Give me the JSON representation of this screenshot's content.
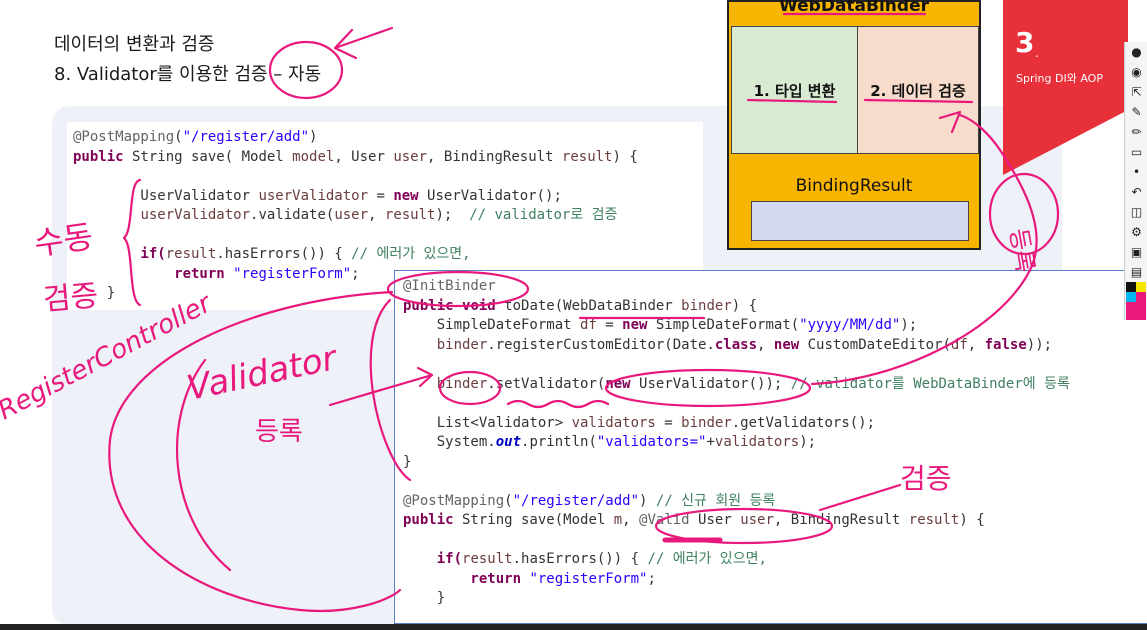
{
  "slide": {
    "heading_line1": "데이터의 변환과 검증",
    "heading_line2": "8. Validator를 이용한 검증 – 자동"
  },
  "code_top": {
    "l1_annot": "@PostMapping",
    "l1_str": "\"/register/add\"",
    "l2a": "public",
    "l2b": " String save( Model ",
    "l2c": "model",
    "l2d": ", User ",
    "l2e": "user",
    "l2f": ", BindingResult ",
    "l2g": "result",
    "l2h": ") {",
    "l3a": "        UserValidator ",
    "l3b": "userValidator",
    "l3c": " = ",
    "l3d": "new",
    "l3e": " UserValidator();",
    "l4a": "        ",
    "l4b": "userValidator",
    "l4c": ".validate(",
    "l4d": "user",
    "l4e": ", ",
    "l4f": "result",
    "l4g": ");  ",
    "l4h": "// validator로 검증",
    "l5a": "        if(",
    "l5b": "result",
    "l5c": ".hasErrors()) { ",
    "l5d": "// 에러가 있으면,",
    "l6a": "            return",
    "l6b": " ",
    "l6c": "\"registerForm\"",
    "l6d": ";",
    "l7": "    }"
  },
  "code_bottom": {
    "b1": "@InitBinder",
    "b2a": "public",
    "b2b": " ",
    "b2c": "void",
    "b2d": " toDate(WebDataBinder ",
    "b2e": "binder",
    "b2f": ") {",
    "b3a": "    SimpleDateFormat ",
    "b3b": "df",
    "b3c": " = ",
    "b3d": "new",
    "b3e": " SimpleDateFormat(",
    "b3f": "\"yyyy/MM/dd\"",
    "b3g": ");",
    "b4a": "    ",
    "b4b": "binder",
    "b4c": ".registerCustomEditor(Date.",
    "b4d": "class",
    "b4e": ", ",
    "b4f": "new",
    "b4g": " CustomDateEditor(",
    "b4h": "df",
    "b4i": ", ",
    "b4j": "false",
    "b4k": "));",
    "b5a": "    ",
    "b5b": "binder",
    "b5c": ".setValidator(",
    "b5d": "new",
    "b5e": " UserValidator()); ",
    "b5f": "// validator를 WebDataBinder에 등록",
    "b6a": "    List<Validator> ",
    "b6b": "validators",
    "b6c": " = ",
    "b6d": "binder",
    "b6e": ".getValidators();",
    "b7a": "    System.",
    "b7b": "out",
    "b7c": ".println(",
    "b7d": "\"validators=\"",
    "b7e": "+",
    "b7f": "validators",
    "b7g": ");",
    "b8": "}",
    "b9a": "@PostMapping",
    "b9b": "(",
    "b9c": "\"/register/add\"",
    "b9d": ") ",
    "b9e": "// 신규 회원 등록",
    "b10a": "public",
    "b10b": " String save(Model ",
    "b10c": "m",
    "b10d": ", ",
    "b10e": "@Valid",
    "b10f": " User ",
    "b10g": "user",
    "b10h": ", BindingResult ",
    "b10i": "result",
    "b10j": ") {",
    "b11a": "    if(",
    "b11b": "result",
    "b11c": ".hasErrors()) { ",
    "b11d": "// 에러가 있으면,",
    "b12a": "        return",
    "b12b": " ",
    "b12c": "\"registerForm\"",
    "b12d": ";",
    "b13": "    }"
  },
  "diagram": {
    "title": "WebDataBinder",
    "box1": "1. 타입 변환",
    "box2": "2. 데이터 검증",
    "result_label": "BindingResult"
  },
  "chapter": {
    "number": "3",
    "dot": ".",
    "title": "Spring DI와 AOP"
  },
  "annotations": {
    "manual": "수동",
    "manual2": "검증",
    "register": "등록",
    "validator": "Validator",
    "validator_reg": "등록",
    "controller": "RegisterController",
    "verify": "검증"
  },
  "toolbar": {
    "icons": [
      "pin-icon",
      "eye-icon",
      "pointer-icon",
      "pen-icon",
      "marker-icon",
      "eraser-icon",
      "dot-icon",
      "undo-icon",
      "trash-icon",
      "settings-icon",
      "camera-icon",
      "clipboard-icon"
    ]
  },
  "colors": {
    "ink": "#e8187c",
    "flag": "#e8303a",
    "diagram_bg": "#f7b500"
  }
}
